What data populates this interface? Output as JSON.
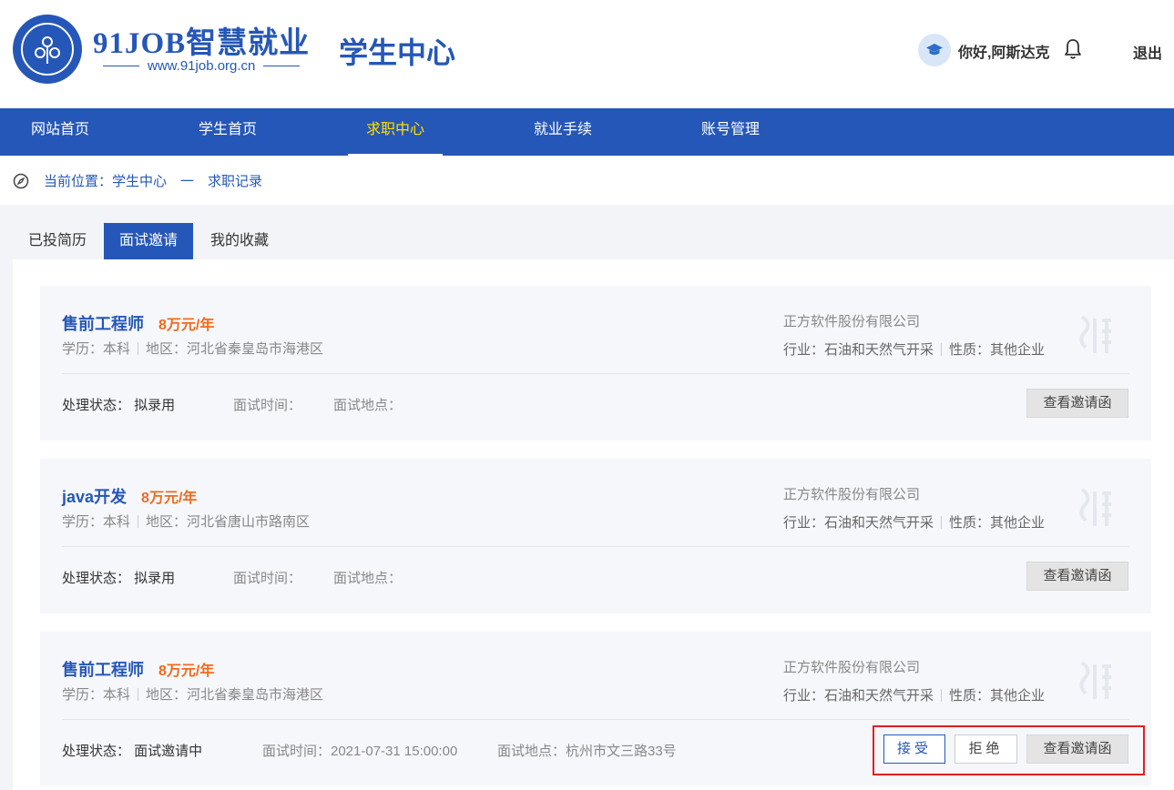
{
  "header": {
    "logo_title": "91JOB智慧就业",
    "logo_url": "www.91job.org.cn",
    "center_title": "学生中心",
    "greeting": "你好,阿斯达克",
    "logout": "退出"
  },
  "nav": {
    "items": [
      {
        "label": "网站首页"
      },
      {
        "label": "学生首页"
      },
      {
        "label": "求职中心"
      },
      {
        "label": "就业手续"
      },
      {
        "label": "账号管理"
      }
    ],
    "active": "求职中心"
  },
  "breadcrumb": {
    "text": "当前位置：学生中心　一　求职记录"
  },
  "tabs": [
    {
      "label": "已投简历"
    },
    {
      "label": "面试邀请"
    },
    {
      "label": "我的收藏"
    }
  ],
  "active_tab": "面试邀请",
  "colors": {
    "brand": "#2557b8",
    "salary": "#f06b1d",
    "nav_active": "#ffe100",
    "highlight": "#e02020"
  },
  "cards": [
    {
      "title": "售前工程师",
      "salary": "8万元/年",
      "education": "学历：本科",
      "region": "地区：河北省秦皇岛市海港区",
      "company": "正方软件股份有限公司",
      "industry": "行业：石油和天然气开采",
      "nature": "性质：其他企业",
      "status": "处理状态：  拟录用",
      "interview_time": "面试时间：",
      "interview_place": "面试地点：",
      "view_btn": "查看邀请函"
    },
    {
      "title": "java开发",
      "salary": "8万元/年",
      "education": "学历：本科",
      "region": "地区：河北省唐山市路南区",
      "company": "正方软件股份有限公司",
      "industry": "行业：石油和天然气开采",
      "nature": "性质：其他企业",
      "status": "处理状态：  拟录用",
      "interview_time": "面试时间：",
      "interview_place": "面试地点：",
      "view_btn": "查看邀请函"
    },
    {
      "title": "售前工程师",
      "salary": "8万元/年",
      "education": "学历：本科",
      "region": "地区：河北省秦皇岛市海港区",
      "company": "正方软件股份有限公司",
      "industry": "行业：石油和天然气开采",
      "nature": "性质：其他企业",
      "status": "处理状态：  面试邀请中",
      "interview_time": "面试时间：2021-07-31 15:00:00",
      "interview_place": "面试地点：杭州市文三路33号",
      "accept_btn": "接受",
      "reject_btn": "拒绝",
      "view_btn": "查看邀请函"
    }
  ]
}
